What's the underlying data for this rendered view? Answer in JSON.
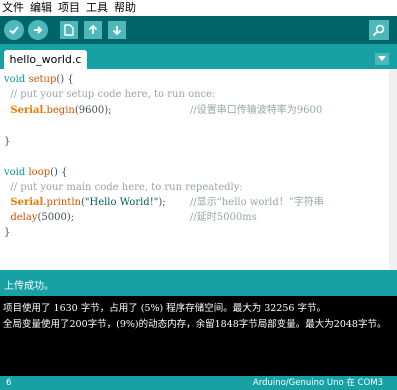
{
  "menubar": {
    "items": [
      "文件",
      "编辑",
      "项目",
      "工具",
      "帮助"
    ]
  },
  "toolbar": {
    "buttons": [
      "verify-icon",
      "upload-icon",
      "new-icon",
      "open-icon",
      "save-icon",
      "serial-monitor-icon"
    ]
  },
  "tabs": {
    "active_tab": "hello_world.c"
  },
  "editor": {
    "lines": {
      "l1_kw": "void",
      "l1_fn": "setup",
      "l1_rest": "() {",
      "l2": "  // put your setup code here, to run once:",
      "l3_cls": "Serial",
      "l3_fn": "begin",
      "l3_rest": "(9600);",
      "l3_cm": "//设置串口传输波特率为9600",
      "l5": "}",
      "l7_kw": "void",
      "l7_fn": "loop",
      "l7_rest": "() {",
      "l8": "  // put your main code here, to run repeatedly:",
      "l9_cls": "Serial",
      "l9_fn": "println",
      "l9_open": "(",
      "l9_str": "\"Hello World!\"",
      "l9_close": ");",
      "l9_cm": "//显示“hello world！”字符串",
      "l10_fn": "delay",
      "l10_rest": "(5000);",
      "l10_cm": "//延时5000ms",
      "l11": "}"
    }
  },
  "status": {
    "message": "上传成功。"
  },
  "console": {
    "line1": "项目使用了 1630 字节，占用了 (5%) 程序存储空间。最大为 32256 字节。",
    "line2": "全局变量使用了200字节，(9%)的动态内存，余留1848字节局部变量。最大为2048字节。"
  },
  "footer": {
    "line_number": "6",
    "board": "Arduino/Genuino Uno 在 COM3"
  },
  "colors": {
    "toolbar_bg": "#006468",
    "tab_bar_bg": "#17a1a5",
    "button_bg": "#4db7bb",
    "console_bg": "#000000"
  }
}
